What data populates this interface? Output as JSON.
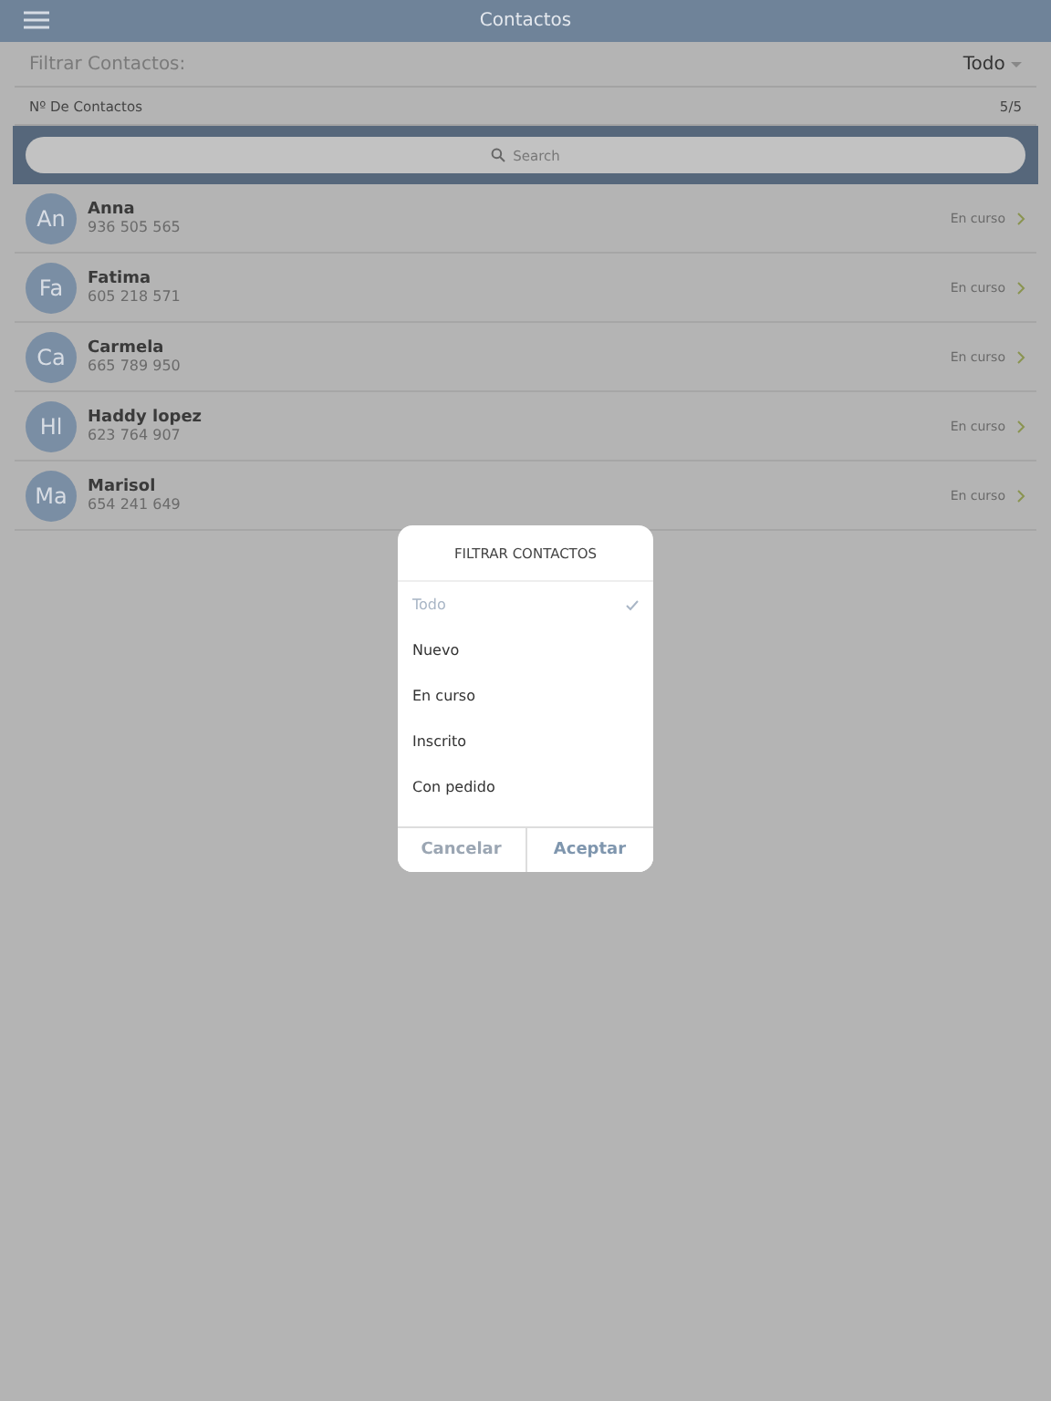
{
  "header": {
    "title": "Contactos"
  },
  "filter": {
    "label": "Filtrar Contactos:",
    "value": "Todo"
  },
  "count": {
    "label": "Nº De Contactos",
    "value": "5/5"
  },
  "search": {
    "placeholder": "Search"
  },
  "contacts": [
    {
      "initials": "An",
      "name": "Anna",
      "phone": "936 505 565",
      "status": "En curso"
    },
    {
      "initials": "Fa",
      "name": "Fatima",
      "phone": "605 218 571",
      "status": "En curso"
    },
    {
      "initials": "Ca",
      "name": "Carmela",
      "phone": "665 789 950",
      "status": "En curso"
    },
    {
      "initials": "Hl",
      "name": "Haddy lopez",
      "phone": "623 764 907",
      "status": "En curso"
    },
    {
      "initials": "Ma",
      "name": "Marisol",
      "phone": "654 241 649",
      "status": "En curso"
    }
  ],
  "dialog": {
    "title": "FILTRAR CONTACTOS",
    "options": [
      {
        "label": "Todo",
        "selected": true
      },
      {
        "label": "Nuevo",
        "selected": false
      },
      {
        "label": "En curso",
        "selected": false
      },
      {
        "label": "Inscrito",
        "selected": false
      },
      {
        "label": "Con pedido",
        "selected": false
      }
    ],
    "buttons": [
      {
        "label": "Cancelar",
        "disabled": true
      },
      {
        "label": "Aceptar",
        "disabled": false
      }
    ]
  }
}
